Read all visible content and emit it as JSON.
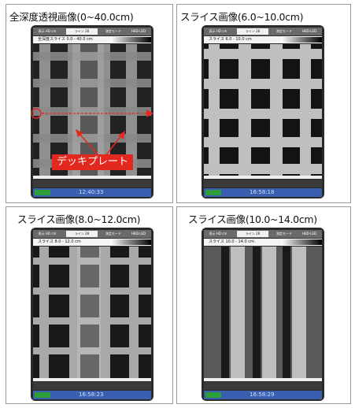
{
  "panels": [
    {
      "title": "全深度透視画像(0~40.0cm)",
      "range": "全深度スライス 0.0 - 40.0 cm",
      "time": "12:40:33",
      "variant": "full"
    },
    {
      "title": "スライス画像(6.0~10.0cm)",
      "range": "スライス 6.0 - 10.0 cm",
      "time": "16:58:18",
      "variant": "grid"
    },
    {
      "title": "スライス画像(8.0~12.0cm)",
      "range": "スライス 8.0 - 12.0 cm",
      "time": "16:58:23",
      "variant": "mixed"
    },
    {
      "title": "スライス画像(10.0~14.0cm)",
      "range": "スライス 10.0 - 14.0 cm",
      "time": "16:58:29",
      "variant": "vertical"
    }
  ],
  "device_tabs": [
    "表示 HD cm",
    "ライン 28",
    "測定モード",
    "HBD-LED"
  ],
  "annotation": {
    "label": "デッキプレート",
    "color": "#e3281f"
  }
}
